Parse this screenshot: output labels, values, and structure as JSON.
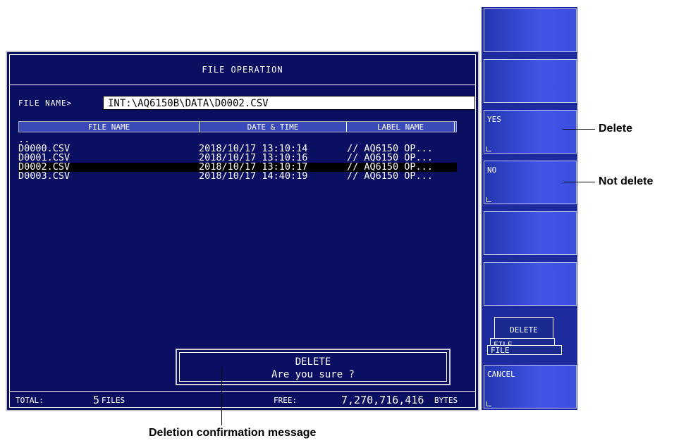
{
  "dialog": {
    "title": "FILE OPERATION",
    "file_name_label": "FILE NAME>",
    "file_name_value": "INT:\\AQ6150B\\DATA\\D0002.CSV"
  },
  "columns": {
    "name": "FILE NAME",
    "date": "DATE & TIME",
    "label": "LABEL NAME"
  },
  "rows": [
    {
      "name": "..",
      "date": "",
      "label": "",
      "selected": false
    },
    {
      "name": "D0000.CSV",
      "date": "2018/10/17 13:10:14",
      "label": "// AQ6150 OP...",
      "selected": false
    },
    {
      "name": "D0001.CSV",
      "date": "2018/10/17 13:10:16",
      "label": "// AQ6150 OP...",
      "selected": false
    },
    {
      "name": "D0002.CSV",
      "date": "2018/10/17 13:10:17",
      "label": "// AQ6150 OP...",
      "selected": true
    },
    {
      "name": "D0003.CSV",
      "date": "2018/10/17 14:40:19",
      "label": "// AQ6150 OP...",
      "selected": false
    }
  ],
  "confirm": {
    "line1": "DELETE",
    "line2": "Are you sure ?"
  },
  "status": {
    "total_label": "TOTAL:",
    "total_value": "5",
    "total_unit": "FILES",
    "free_label": "FREE:",
    "free_value": "7,270,716,416",
    "free_unit": "BYTES"
  },
  "softkeys": {
    "yes": "YES",
    "no": "NO",
    "delete": "DELETE",
    "file1": "FILE",
    "file2": "FILE",
    "cancel": "CANCEL"
  },
  "callouts": {
    "delete": "Delete",
    "not_delete": "Not delete",
    "confirm_msg": "Deletion confirmation message"
  },
  "colors": {
    "dialog_bg": "#0a0f62",
    "header_bg": "#3a4ab8",
    "softkey_bg": "#3e55e6"
  }
}
